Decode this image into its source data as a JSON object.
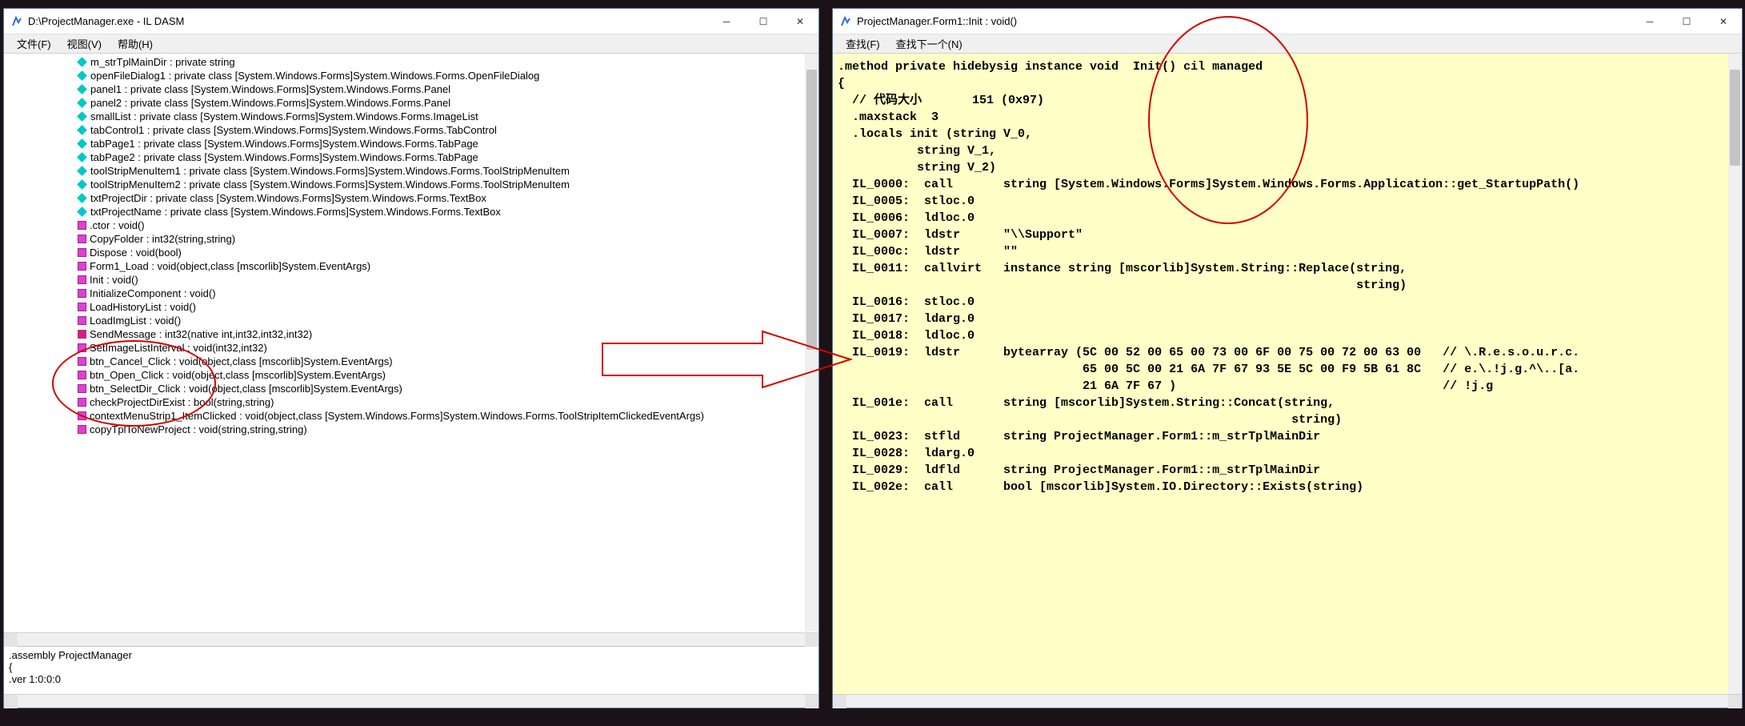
{
  "left_window": {
    "title": "D:\\ProjectManager.exe - IL DASM",
    "menu": {
      "file": "文件(F)",
      "view": "视图(V)",
      "help": "帮助(H)"
    },
    "tree": [
      {
        "icon": "field",
        "label": "m_strTplMainDir : private string"
      },
      {
        "icon": "field",
        "label": "openFileDialog1 : private class [System.Windows.Forms]System.Windows.Forms.OpenFileDialog"
      },
      {
        "icon": "field",
        "label": "panel1 : private class [System.Windows.Forms]System.Windows.Forms.Panel"
      },
      {
        "icon": "field",
        "label": "panel2 : private class [System.Windows.Forms]System.Windows.Forms.Panel"
      },
      {
        "icon": "field",
        "label": "smallList : private class [System.Windows.Forms]System.Windows.Forms.ImageList"
      },
      {
        "icon": "field",
        "label": "tabControl1 : private class [System.Windows.Forms]System.Windows.Forms.TabControl"
      },
      {
        "icon": "field",
        "label": "tabPage1 : private class [System.Windows.Forms]System.Windows.Forms.TabPage"
      },
      {
        "icon": "field",
        "label": "tabPage2 : private class [System.Windows.Forms]System.Windows.Forms.TabPage"
      },
      {
        "icon": "field",
        "label": "toolStripMenuItem1 : private class [System.Windows.Forms]System.Windows.Forms.ToolStripMenuItem"
      },
      {
        "icon": "field",
        "label": "toolStripMenuItem2 : private class [System.Windows.Forms]System.Windows.Forms.ToolStripMenuItem"
      },
      {
        "icon": "field",
        "label": "txtProjectDir : private class [System.Windows.Forms]System.Windows.Forms.TextBox"
      },
      {
        "icon": "field",
        "label": "txtProjectName : private class [System.Windows.Forms]System.Windows.Forms.TextBox"
      },
      {
        "icon": "method",
        "label": ".ctor : void()"
      },
      {
        "icon": "method",
        "label": "CopyFolder : int32(string,string)"
      },
      {
        "icon": "method",
        "label": "Dispose : void(bool)"
      },
      {
        "icon": "method",
        "label": "Form1_Load : void(object,class [mscorlib]System.EventArgs)"
      },
      {
        "icon": "method",
        "label": "Init : void()"
      },
      {
        "icon": "method",
        "label": "InitializeComponent : void()"
      },
      {
        "icon": "method",
        "label": "LoadHistoryList : void()"
      },
      {
        "icon": "method",
        "label": "LoadImgList : void()"
      },
      {
        "icon": "special",
        "label": "SendMessage : int32(native int,int32,int32,int32)"
      },
      {
        "icon": "method",
        "label": "SetImageListInterval : void(int32,int32)"
      },
      {
        "icon": "method",
        "label": "btn_Cancel_Click : void(object,class [mscorlib]System.EventArgs)"
      },
      {
        "icon": "method",
        "label": "btn_Open_Click : void(object,class [mscorlib]System.EventArgs)"
      },
      {
        "icon": "method",
        "label": "btn_SelectDir_Click : void(object,class [mscorlib]System.EventArgs)"
      },
      {
        "icon": "method",
        "label": "checkProjectDirExist : bool(string,string)"
      },
      {
        "icon": "method",
        "label": "contextMenuStrip1_ItemClicked : void(object,class [System.Windows.Forms]System.Windows.Forms.ToolStripItemClickedEventArgs)"
      },
      {
        "icon": "method",
        "label": "copyTplToNewProject : void(string,string,string)"
      }
    ],
    "status": ".assembly ProjectManager\n{\n.ver 1:0:0:0"
  },
  "right_window": {
    "title": "ProjectManager.Form1::Init : void()",
    "menu": {
      "find": "查找(F)",
      "find_next": "查找下一个(N)"
    },
    "code": ".method private hidebysig instance void  Init() cil managed\n{\n  // 代码大小       151 (0x97)\n  .maxstack  3\n  .locals init (string V_0,\n           string V_1,\n           string V_2)\n  IL_0000:  call       string [System.Windows.Forms]System.Windows.Forms.Application::get_StartupPath()\n  IL_0005:  stloc.0\n  IL_0006:  ldloc.0\n  IL_0007:  ldstr      \"\\\\Support\"\n  IL_000c:  ldstr      \"\"\n  IL_0011:  callvirt   instance string [mscorlib]System.String::Replace(string,\n                                                                        string)\n  IL_0016:  stloc.0\n  IL_0017:  ldarg.0\n  IL_0018:  ldloc.0\n  IL_0019:  ldstr      bytearray (5C 00 52 00 65 00 73 00 6F 00 75 00 72 00 63 00   // \\.R.e.s.o.u.r.c.\n                                  65 00 5C 00 21 6A 7F 67 93 5E 5C 00 F9 5B 61 8C   // e.\\.!j.g.^\\..[a.\n                                  21 6A 7F 67 )                                     // !j.g\n  IL_001e:  call       string [mscorlib]System.String::Concat(string,\n                                                               string)\n  IL_0023:  stfld      string ProjectManager.Form1::m_strTplMainDir\n  IL_0028:  ldarg.0\n  IL_0029:  ldfld      string ProjectManager.Form1::m_strTplMainDir\n  IL_002e:  call       bool [mscorlib]System.IO.Directory::Exists(string)"
  }
}
